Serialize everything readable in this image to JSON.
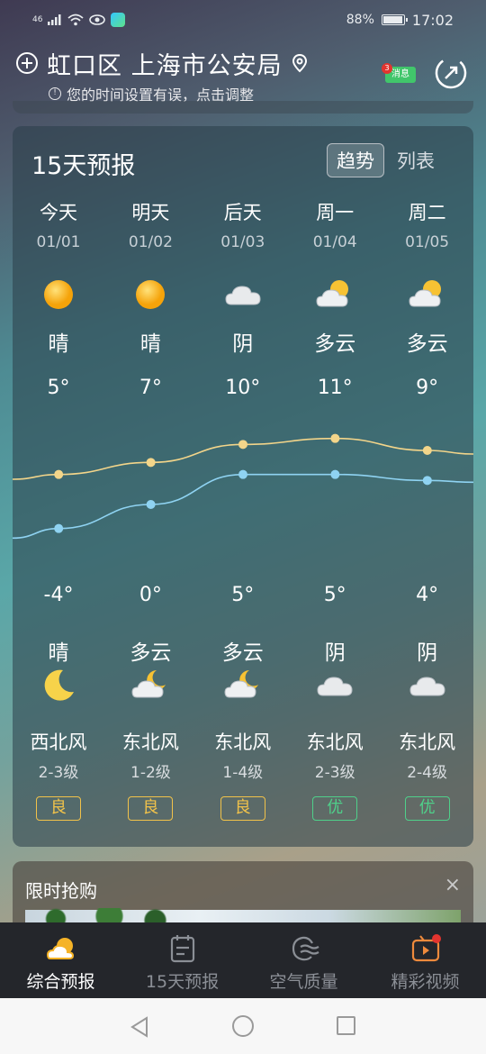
{
  "status_bar": {
    "signal": "46",
    "battery": "88%",
    "battery_level": 0.88,
    "time": "17:02"
  },
  "header": {
    "location": "虹口区 上海市公安局",
    "time_warning": "您的时间设置有误，点击调整",
    "message_label": "消息",
    "message_badge": "3"
  },
  "forecast": {
    "title": "15天预报",
    "toggle": {
      "active": "趋势",
      "inactive": "列表"
    },
    "days": [
      {
        "day": "今天",
        "date": "01/01",
        "weather_day": "晴",
        "day_icon": "sun-icon",
        "high": "5°",
        "low": "-4°",
        "weather_night": "晴",
        "night_icon": "moon-icon",
        "wind_dir": "西北风",
        "wind_level": "2-3级",
        "aqi": "良",
        "aqi_color": "#f1c24a"
      },
      {
        "day": "明天",
        "date": "01/02",
        "weather_day": "晴",
        "day_icon": "sun-icon",
        "high": "7°",
        "low": "0°",
        "weather_night": "多云",
        "night_icon": "cloud-moon-icon",
        "wind_dir": "东北风",
        "wind_level": "1-2级",
        "aqi": "良",
        "aqi_color": "#f1c24a"
      },
      {
        "day": "后天",
        "date": "01/03",
        "weather_day": "阴",
        "day_icon": "cloud-icon",
        "high": "10°",
        "low": "5°",
        "weather_night": "多云",
        "night_icon": "cloud-moon-icon",
        "wind_dir": "东北风",
        "wind_level": "1-4级",
        "aqi": "良",
        "aqi_color": "#f1c24a"
      },
      {
        "day": "周一",
        "date": "01/04",
        "weather_day": "多云",
        "day_icon": "cloud-sun-icon",
        "high": "11°",
        "low": "5°",
        "weather_night": "阴",
        "night_icon": "cloud-icon",
        "wind_dir": "东北风",
        "wind_level": "2-3级",
        "aqi": "优",
        "aqi_color": "#4fd08a"
      },
      {
        "day": "周二",
        "date": "01/05",
        "weather_day": "多云",
        "day_icon": "cloud-sun-icon",
        "high": "9°",
        "low": "4°",
        "weather_night": "阴",
        "night_icon": "cloud-icon",
        "wind_dir": "东北风",
        "wind_level": "2-4级",
        "aqi": "优",
        "aqi_color": "#4fd08a"
      }
    ],
    "high_values": [
      5,
      7,
      10,
      11,
      9
    ],
    "low_values": [
      -4,
      0,
      5,
      5,
      4
    ],
    "high_color": "#f3d58a",
    "low_color": "#8fd3f2"
  },
  "promo": {
    "title": "限时抢购",
    "close": "×"
  },
  "tabs": [
    {
      "label": "综合预报",
      "icon": "weather-overview-icon",
      "active": true
    },
    {
      "label": "15天预报",
      "icon": "calendar-icon",
      "active": false
    },
    {
      "label": "空气质量",
      "icon": "air-quality-icon",
      "active": false
    },
    {
      "label": "精彩视频",
      "icon": "video-icon",
      "active": false
    }
  ]
}
